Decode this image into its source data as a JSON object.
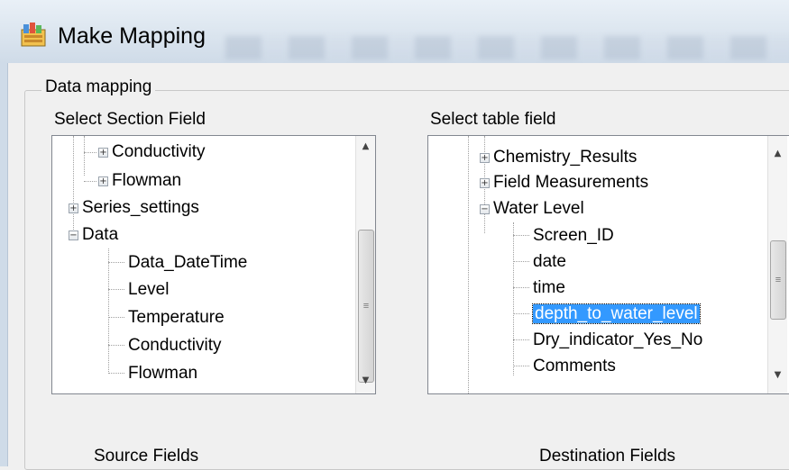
{
  "window": {
    "title": "Make Mapping",
    "icon": "app-icon"
  },
  "group": {
    "legend": "Data mapping"
  },
  "left_panel": {
    "label": "Select Section Field",
    "rows": [
      {
        "label": "Conductivity",
        "expander": "+"
      },
      {
        "label": "Flowman",
        "expander": "+"
      },
      {
        "label": "Series_settings",
        "expander": "+"
      },
      {
        "label": "Data",
        "expander": "-"
      },
      {
        "label": "Data_DateTime"
      },
      {
        "label": "Level"
      },
      {
        "label": "Temperature"
      },
      {
        "label": "Conductivity"
      },
      {
        "label": "Flowman"
      }
    ]
  },
  "right_panel": {
    "label": "Select table field",
    "rows": [
      {
        "label": "Chemistry_Results",
        "expander": "+"
      },
      {
        "label": "Field Measurements",
        "expander": "+"
      },
      {
        "label": "Water Level",
        "expander": "-"
      },
      {
        "label": "Screen_ID"
      },
      {
        "label": "date"
      },
      {
        "label": "time"
      },
      {
        "label": "depth_to_water_level",
        "selected": true
      },
      {
        "label": "Dry_indicator_Yes_No"
      },
      {
        "label": "Comments"
      }
    ]
  },
  "footer": {
    "source_label": "Source Fields",
    "destination_label": "Destination Fields"
  },
  "colors": {
    "selection": "#3399ff",
    "titlebar": "#dfe8f1"
  }
}
